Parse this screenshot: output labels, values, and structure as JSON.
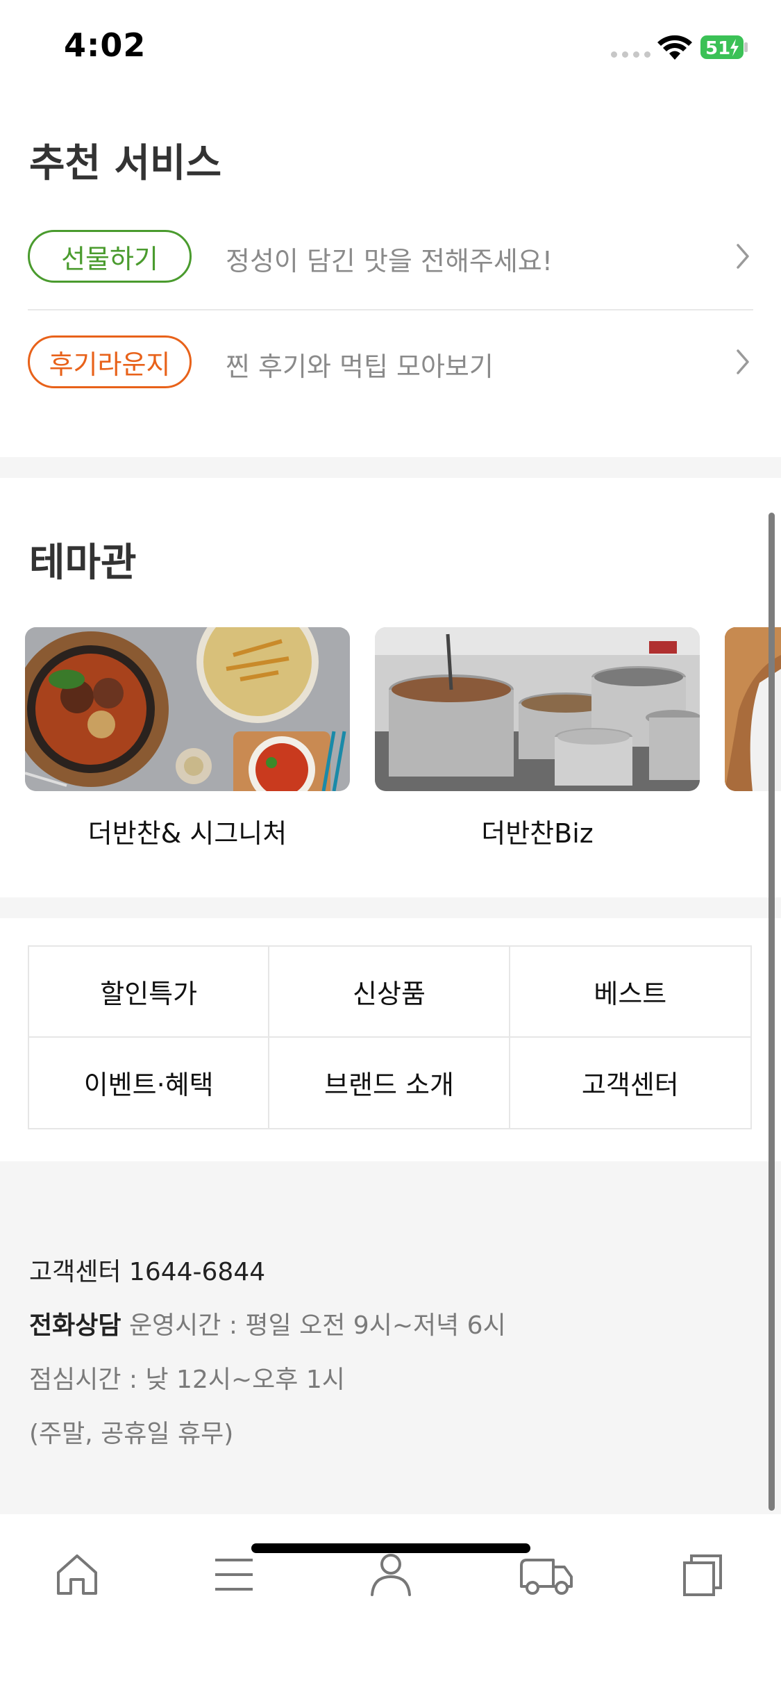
{
  "status_bar": {
    "time": "4:02",
    "battery": "51"
  },
  "recommended": {
    "title": "추천 서비스",
    "items": [
      {
        "pill": "선물하기",
        "text": "정성이 담긴 맛을 전해주세요!",
        "color": "#4a9b2e"
      },
      {
        "pill": "후기라운지",
        "text": "찐 후기와 먹팁 모아보기",
        "color": "#e8621a"
      }
    ]
  },
  "theme": {
    "title": "테마관",
    "cards": [
      {
        "label": "더반찬& 시그니처"
      },
      {
        "label": "더반찬Biz"
      }
    ]
  },
  "menu": [
    "할인특가",
    "신상품",
    "베스트",
    "이벤트·혜택",
    "브랜드 소개",
    "고객센터"
  ],
  "footer": {
    "cs_title": "고객센터 1644-6844",
    "phone_label": "전화상담",
    "hours": "운영시간 : 평일 오전 9시~저녁 6시",
    "lunch": "점심시간 : 낮 12시~오후 1시",
    "holiday": "(주말, 공휴일 휴무)"
  },
  "tab_bar": {
    "icons": [
      "home-icon",
      "menu-icon",
      "user-icon",
      "delivery-truck-icon",
      "recent-icon"
    ]
  }
}
